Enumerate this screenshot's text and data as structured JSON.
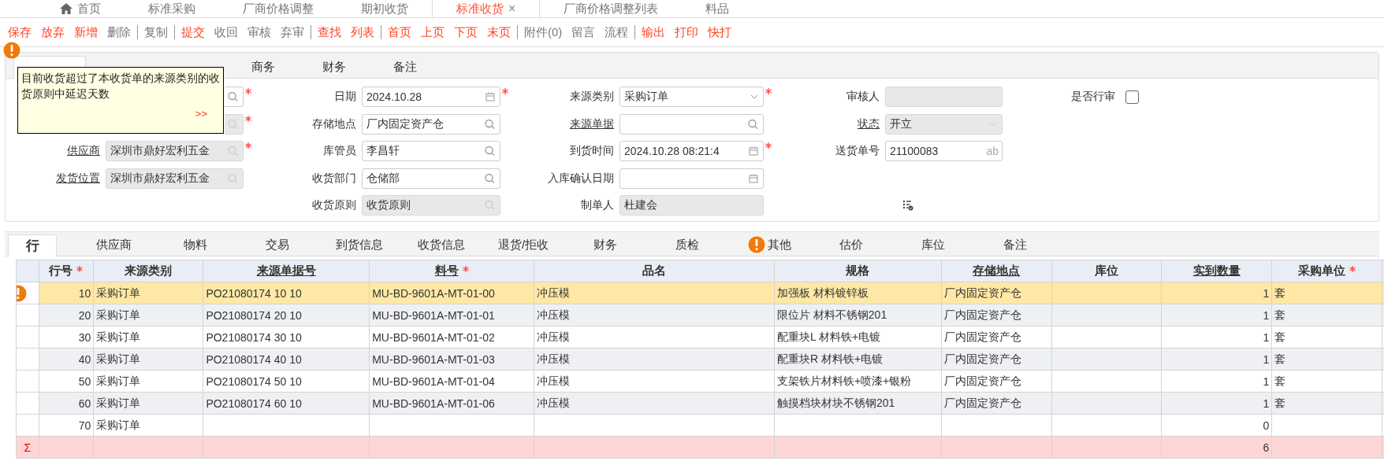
{
  "top_tabs": [
    {
      "label": "首页",
      "kind": "home",
      "selected": false
    },
    {
      "label": "标准采购",
      "kind": "page",
      "selected": false
    },
    {
      "label": "厂商价格调整",
      "kind": "page",
      "selected": false
    },
    {
      "label": "期初收货",
      "kind": "page",
      "selected": false
    },
    {
      "label": "标准收货",
      "kind": "page",
      "selected": true,
      "close": "×"
    },
    {
      "label": "厂商价格调整列表",
      "kind": "page",
      "selected": false
    },
    {
      "label": "料品",
      "kind": "page",
      "selected": false
    }
  ],
  "toolbar": {
    "groups": [
      {
        "items": [
          {
            "label": "保存",
            "disabled": false
          },
          {
            "label": "放弃",
            "disabled": false
          },
          {
            "label": "新增",
            "disabled": false
          },
          {
            "label": "删除",
            "disabled": true
          }
        ]
      },
      {
        "items": [
          {
            "label": "复制",
            "disabled": true
          }
        ]
      },
      {
        "items": [
          {
            "label": "提交",
            "disabled": false
          },
          {
            "label": "收回",
            "disabled": true
          },
          {
            "label": "审核",
            "disabled": true
          },
          {
            "label": "弃审",
            "disabled": true
          }
        ]
      },
      {
        "items": [
          {
            "label": "查找",
            "disabled": false
          },
          {
            "label": "列表",
            "disabled": false
          }
        ]
      },
      {
        "items": [
          {
            "label": "首页",
            "disabled": false
          },
          {
            "label": "上页",
            "disabled": false
          },
          {
            "label": "下页",
            "disabled": false
          },
          {
            "label": "末页",
            "disabled": false
          }
        ]
      },
      {
        "items": [
          {
            "label": "附件(0)",
            "disabled": true
          },
          {
            "label": "留言",
            "disabled": true
          },
          {
            "label": "流程",
            "disabled": true
          }
        ]
      },
      {
        "items": [
          {
            "label": "输出",
            "disabled": false
          },
          {
            "label": "打印",
            "disabled": false
          },
          {
            "label": "快打",
            "disabled": false
          }
        ]
      }
    ]
  },
  "form": {
    "tabs": [
      {
        "label": "商务",
        "selected": false
      },
      {
        "label": "财务",
        "selected": false
      },
      {
        "label": "备注",
        "selected": false
      }
    ],
    "tooltip": {
      "text": "目前收货超过了本收货单的来源类别的收货原则中延迟天数",
      "link": ">>"
    },
    "columns": [
      {
        "fields": [
          {
            "kind": "lookup",
            "disabled": false,
            "required": true
          },
          {
            "kind": "lookup",
            "disabled": true,
            "required": true
          },
          {
            "label": "供应商",
            "link": true,
            "kind": "lookup",
            "value": "深圳市鼎好宏利五金",
            "disabled": true,
            "required": true
          },
          {
            "label": "发货位置",
            "link": true,
            "kind": "lookup",
            "value": "深圳市鼎好宏利五金",
            "disabled": true,
            "required": false
          }
        ]
      },
      {
        "fields": [
          {
            "label": "日期",
            "link": false,
            "kind": "date",
            "value": "2024.10.28",
            "disabled": false,
            "required": true
          },
          {
            "label": "存储地点",
            "link": false,
            "kind": "lookup",
            "value": "厂内固定资产仓",
            "disabled": false,
            "required": false
          },
          {
            "label": "库管员",
            "link": false,
            "kind": "lookup",
            "value": "李昌轩",
            "disabled": false,
            "required": false
          },
          {
            "label": "收货部门",
            "link": false,
            "kind": "lookup",
            "value": "仓储部",
            "disabled": false,
            "required": false
          },
          {
            "label": "收货原则",
            "link": false,
            "kind": "lookup",
            "value": "收货原则",
            "disabled": true,
            "required": false
          }
        ]
      },
      {
        "fields": [
          {
            "label": "来源类别",
            "link": false,
            "kind": "select",
            "value": "采购订单",
            "disabled": false,
            "required": true
          },
          {
            "label": "来源单据",
            "link": true,
            "kind": "lookup",
            "disabled": false,
            "required": false
          },
          {
            "label": "到货时间",
            "link": false,
            "kind": "date",
            "value": "2024.10.28 08:21:4",
            "disabled": false,
            "required": true
          },
          {
            "label": "入库确认日期",
            "link": false,
            "kind": "date",
            "disabled": false,
            "required": false
          },
          {
            "label": "制单人",
            "link": false,
            "kind": "text",
            "value": "杜建会",
            "disabled": true,
            "required": false
          }
        ]
      },
      {
        "fields": [
          {
            "label": "审核人",
            "link": false,
            "kind": "text",
            "disabled": true,
            "required": false
          },
          {
            "label": "状态",
            "link": true,
            "kind": "select",
            "value": "开立",
            "disabled": true,
            "required": false
          },
          {
            "label": "送货单号",
            "link": false,
            "kind": "text",
            "value": "21100083",
            "suffix": "ab",
            "disabled": false,
            "required": false
          }
        ]
      },
      {
        "fields": [
          {
            "label": "是否行审",
            "link": false,
            "kind": "checkbox",
            "checked": false
          }
        ]
      }
    ]
  },
  "line_tabs": [
    {
      "label": "行",
      "selected": true,
      "warning": false
    },
    {
      "label": "供应商",
      "selected": false,
      "warning": false
    },
    {
      "label": "物料",
      "selected": false,
      "warning": false
    },
    {
      "label": "交易",
      "selected": false,
      "warning": false
    },
    {
      "label": "到货信息",
      "selected": false,
      "warning": false
    },
    {
      "label": "收货信息",
      "selected": false,
      "warning": false
    },
    {
      "label": "退货/拒收",
      "selected": false,
      "warning": false
    },
    {
      "label": "财务",
      "selected": false,
      "warning": false
    },
    {
      "label": "质检",
      "selected": false,
      "warning": false
    },
    {
      "label": "其他",
      "selected": false,
      "warning": true
    },
    {
      "label": "估价",
      "selected": false,
      "warning": false
    },
    {
      "label": "库位",
      "selected": false,
      "warning": false
    },
    {
      "label": "备注",
      "selected": false,
      "warning": false
    }
  ],
  "table": {
    "columns": [
      {
        "label": "行号",
        "kind": "number",
        "required": true,
        "underlined": false
      },
      {
        "label": "来源类别",
        "kind": "text",
        "required": false,
        "underlined": false
      },
      {
        "label": "来源单据号",
        "kind": "text",
        "required": false,
        "underlined": true
      },
      {
        "label": "料号",
        "kind": "text",
        "required": true,
        "underlined": true
      },
      {
        "label": "品名",
        "kind": "text",
        "required": false,
        "underlined": false
      },
      {
        "label": "规格",
        "kind": "text",
        "required": false,
        "underlined": false
      },
      {
        "label": "存储地点",
        "kind": "text",
        "required": false,
        "underlined": true
      },
      {
        "label": "库位",
        "kind": "text",
        "required": false,
        "underlined": false
      },
      {
        "label": "实到数量",
        "kind": "number",
        "required": false,
        "underlined": true
      },
      {
        "label": "采购单位",
        "kind": "text",
        "required": true,
        "underlined": false
      }
    ],
    "rows": [
      {
        "selected": true,
        "warning": true,
        "cells": [
          "10",
          "采购订单",
          "PO21080174 10 10",
          "MU-BD-9601A-MT-01-00",
          "冲压模",
          "加强板  材料镀锌板",
          "厂内固定资产仓",
          null,
          "1",
          "套"
        ]
      },
      {
        "selected": false,
        "warning": false,
        "cells": [
          "20",
          "采购订单",
          "PO21080174 20 10",
          "MU-BD-9601A-MT-01-01",
          "冲压模",
          "限位片 材料不锈钢201",
          "厂内固定资产仓",
          null,
          "1",
          "套"
        ]
      },
      {
        "selected": false,
        "warning": false,
        "cells": [
          "30",
          "采购订单",
          "PO21080174 30 10",
          "MU-BD-9601A-MT-01-02",
          "冲压模",
          "配重块L 材料铁+电镀",
          "厂内固定资产仓",
          null,
          "1",
          "套"
        ]
      },
      {
        "selected": false,
        "warning": false,
        "cells": [
          "40",
          "采购订单",
          "PO21080174 40 10",
          "MU-BD-9601A-MT-01-03",
          "冲压模",
          "配重块R 材料铁+电镀",
          "厂内固定资产仓",
          null,
          "1",
          "套"
        ]
      },
      {
        "selected": false,
        "warning": false,
        "cells": [
          "50",
          "采购订单",
          "PO21080174 50 10",
          "MU-BD-9601A-MT-01-04",
          "冲压模",
          "支架铁片材料铁+喷漆+银粉",
          "厂内固定资产仓",
          null,
          "1",
          "套"
        ]
      },
      {
        "selected": false,
        "warning": false,
        "cells": [
          "60",
          "采购订单",
          "PO21080174 60 10",
          "MU-BD-9601A-MT-01-06",
          "冲压模",
          "触摸档块材块不锈钢201",
          "厂内固定资产仓",
          null,
          "1",
          "套"
        ]
      },
      {
        "selected": false,
        "warning": false,
        "cells": [
          "70",
          "采购订单",
          null,
          null,
          null,
          null,
          null,
          null,
          "0",
          null
        ]
      }
    ],
    "sum_row": {
      "symbol": "Σ",
      "cells": [
        null,
        null,
        null,
        null,
        null,
        null,
        null,
        null,
        "6",
        null
      ]
    }
  }
}
